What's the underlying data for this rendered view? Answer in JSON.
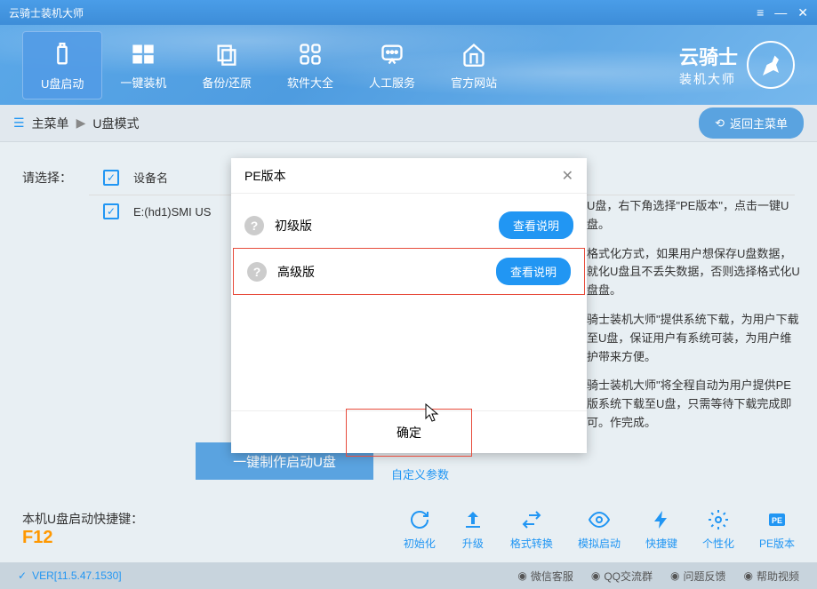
{
  "titlebar": {
    "title": "云骑士装机大师"
  },
  "nav": {
    "usb": "U盘启动",
    "oneclick": "一键装机",
    "backup": "备份/还原",
    "software": "软件大全",
    "service": "人工服务",
    "website": "官方网站"
  },
  "brand": {
    "title": "云骑士",
    "sub": "装机大师"
  },
  "breadcrumb": {
    "main": "主菜单",
    "current": "U盘模式",
    "back": "返回主菜单"
  },
  "content": {
    "select_label": "请选择：",
    "col_device": "设备名",
    "device_name": "E:(hd1)SMI US"
  },
  "instructions": {
    "p1": "U盘，右下角选择\"PE版本\"，点击一键U盘。",
    "p2": "格式化方式，如果用户想保存U盘数据，就化U盘且不丢失数据，否则选择格式化U盘盘。",
    "p3": "骑士装机大师\"提供系统下载，为用户下载至U盘，保证用户有系统可装，为用户维护带来方便。",
    "p4": "骑士装机大师\"将全程自动为用户提供PE版系统下载至U盘，只需等待下载完成即可。作完成。"
  },
  "actions": {
    "make_btn": "一键制作启动U盘",
    "custom": "自定义参数"
  },
  "hotkey": {
    "label": "本机U盘启动快捷键：",
    "value": "F12"
  },
  "tools": {
    "init": "初始化",
    "upgrade": "升级",
    "format": "格式转换",
    "simulate": "模拟启动",
    "shortcut": "快捷键",
    "personal": "个性化",
    "pe": "PE版本"
  },
  "status": {
    "version": "VER[11.5.47.1530]",
    "wechat": "微信客服",
    "qq": "QQ交流群",
    "feedback": "问题反馈",
    "help": "帮助视频"
  },
  "modal": {
    "title": "PE版本",
    "basic": "初级版",
    "advanced": "高级版",
    "view_btn": "查看说明",
    "confirm": "确定"
  }
}
